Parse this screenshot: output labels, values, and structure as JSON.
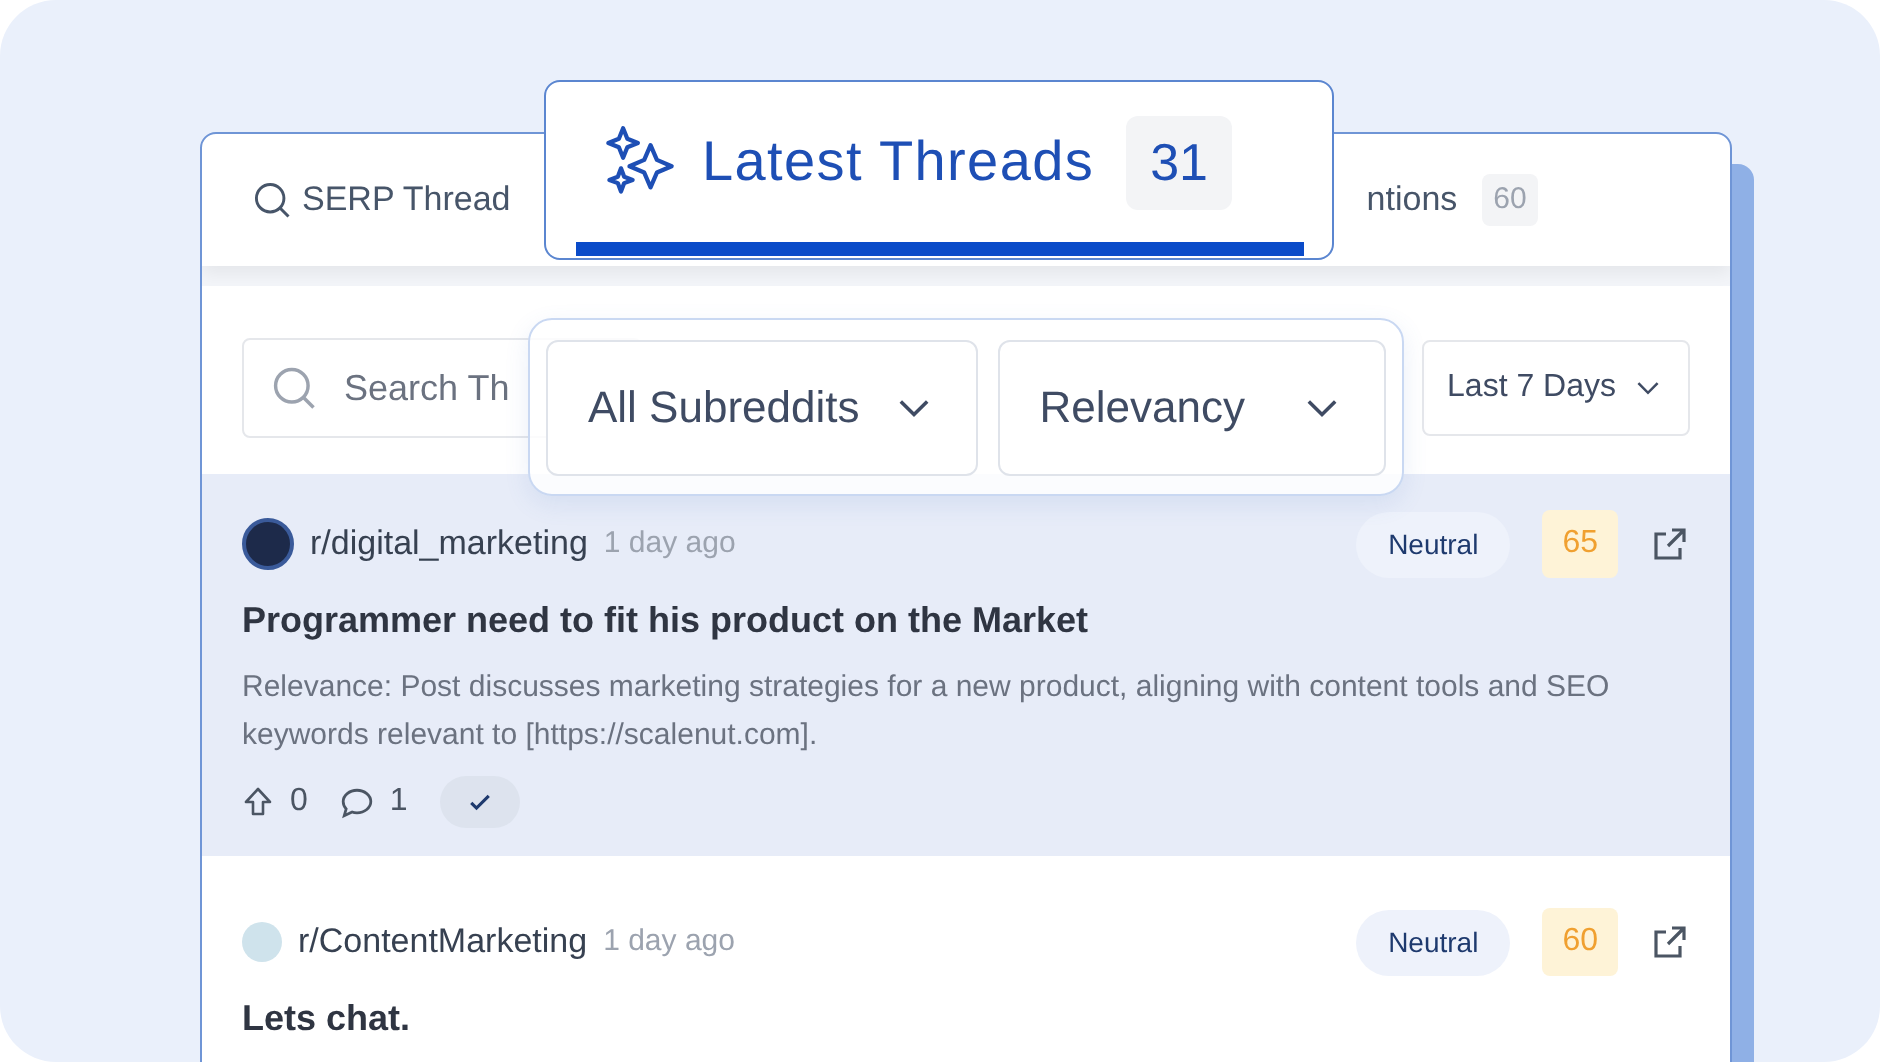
{
  "tabs": [
    {
      "label": "SERP Thread",
      "selected": false
    },
    {
      "label": "Latest Threads",
      "count": "31",
      "selected": true
    },
    {
      "label": "ntions",
      "count": "60",
      "selected": false
    }
  ],
  "search": {
    "placeholder": "Search Th"
  },
  "filters": [
    {
      "label": "All Subreddits",
      "highlighted": true
    },
    {
      "label": "Relevancy",
      "highlighted": true
    },
    {
      "label": "Last 7 Days",
      "highlighted": false
    }
  ],
  "posts": [
    {
      "subreddit": "r/digital_marketing",
      "time": "1 day ago",
      "sentiment": "Neutral",
      "score": "65",
      "title": "Programmer need to fit his product on the Market",
      "relevance": "Relevance: Post discusses marketing strategies for a new product, aligning with content tools and SEO keywords relevant to [https://scalenut.com].",
      "upvotes": "0",
      "comments": "1",
      "reviewed": true,
      "selected": true
    },
    {
      "subreddit": "r/ContentMarketing",
      "time": "1 day ago",
      "sentiment": "Neutral",
      "score": "60",
      "title": "Lets chat.",
      "selected": false
    }
  ]
}
